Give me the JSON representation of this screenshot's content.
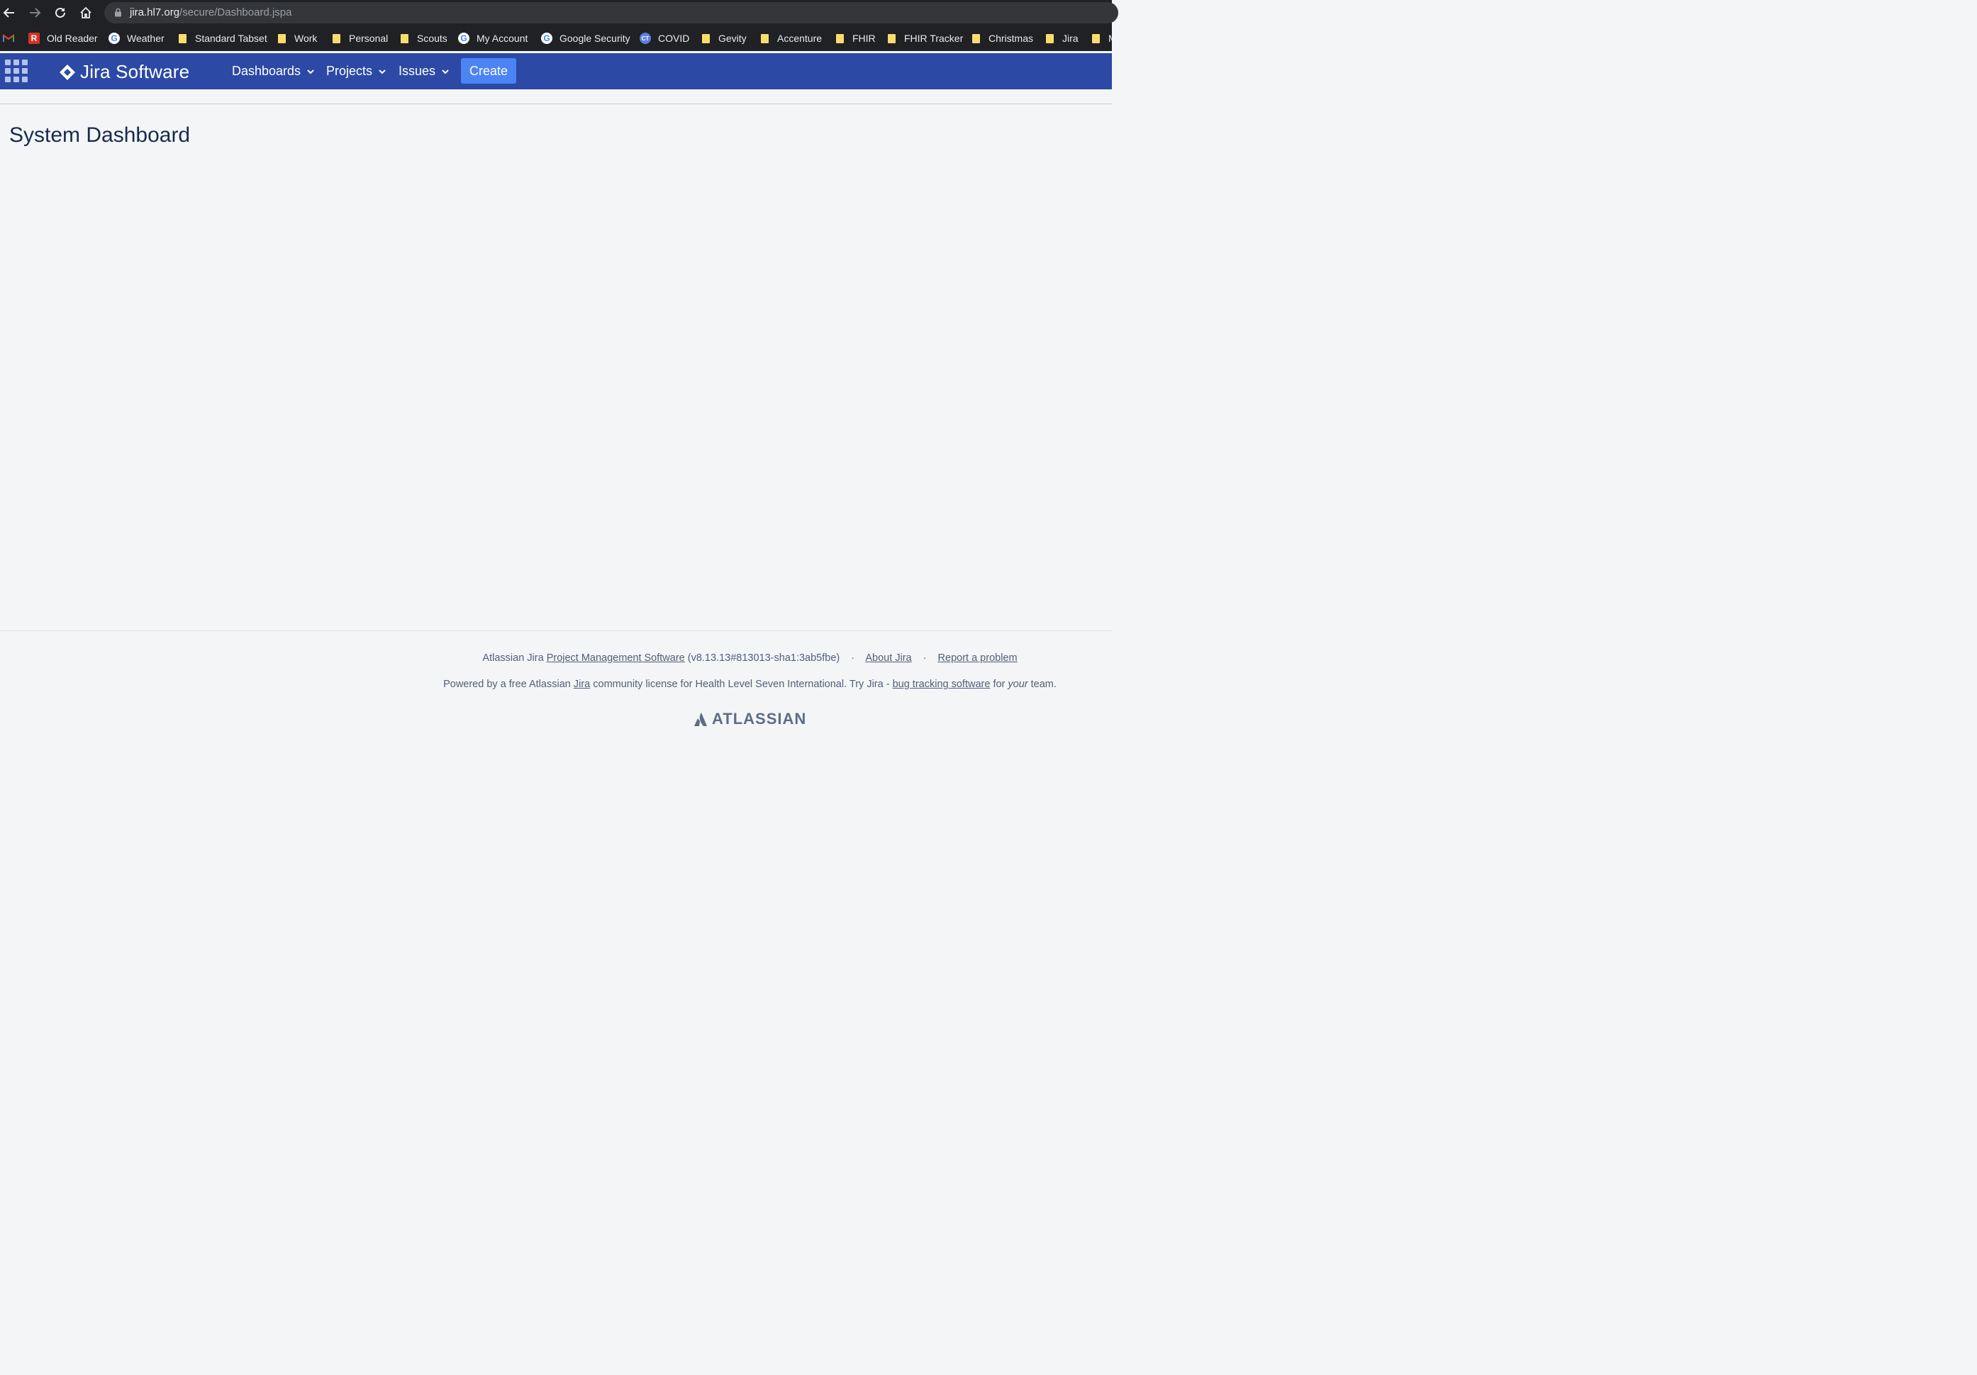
{
  "browser": {
    "url_host": "jira.hl7.org",
    "url_path": "/secure/Dashboard.jspa",
    "bookmarks": [
      {
        "label": "Old Reader",
        "icon": "reader-icon"
      },
      {
        "label": "Weather",
        "icon": "google-icon"
      },
      {
        "label": "Standard Tabset",
        "icon": "folder-icon"
      },
      {
        "label": "Work",
        "icon": "folder-icon"
      },
      {
        "label": "Personal",
        "icon": "folder-icon"
      },
      {
        "label": "Scouts",
        "icon": "folder-icon"
      },
      {
        "label": "My Account",
        "icon": "google-icon"
      },
      {
        "label": "Google Security",
        "icon": "google-icon"
      },
      {
        "label": "COVID",
        "icon": "ct-icon"
      },
      {
        "label": "Gevity",
        "icon": "folder-icon"
      },
      {
        "label": "Accenture",
        "icon": "folder-icon"
      },
      {
        "label": "FHIR",
        "icon": "folder-icon"
      },
      {
        "label": "FHIR Tracker",
        "icon": "folder-icon"
      },
      {
        "label": "Christmas",
        "icon": "folder-icon"
      },
      {
        "label": "Jira",
        "icon": "folder-icon"
      },
      {
        "label": "M",
        "icon": "folder-icon"
      }
    ]
  },
  "header": {
    "product": "Jira Software",
    "menu": {
      "dashboards": "Dashboards",
      "projects": "Projects",
      "issues": "Issues"
    },
    "create": "Create",
    "color": "#2c49a6",
    "create_color": "#4c84f5"
  },
  "main": {
    "title": "System Dashboard"
  },
  "footer": {
    "line1_prefix": "Atlassian Jira",
    "line1_link": "Project Management Software",
    "line1_version": "(v8.13.13#813013-sha1:3ab5fbe)",
    "about": "About Jira",
    "report": "Report a problem",
    "line2_a": "Powered by a free Atlassian",
    "line2_jira": "Jira",
    "line2_b": "community license for Health Level Seven International. Try Jira -",
    "line2_link": "bug tracking software",
    "line2_for": "for",
    "line2_your": "your",
    "line2_team": "team.",
    "brand": "ATLASSIAN"
  }
}
